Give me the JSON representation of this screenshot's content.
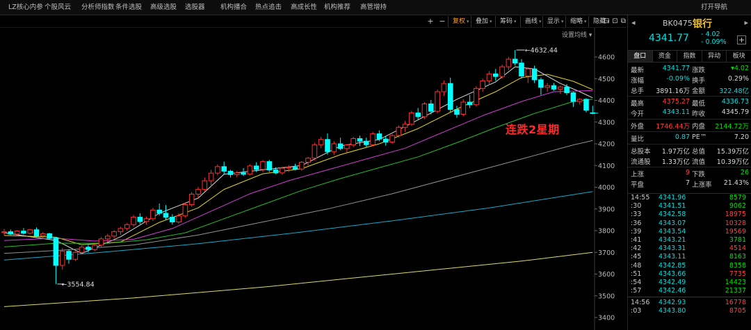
{
  "menu": {
    "items": [
      "LZ核心内参",
      "个股风云",
      "分析师指数",
      "条件选股",
      "高级选股",
      "选股器",
      "机构播合",
      "热点追击",
      "高成长性",
      "机构推荐",
      "高管增持"
    ],
    "right_link": "打开导航"
  },
  "toolbar": {
    "icons": [
      "+",
      "−"
    ],
    "items": [
      {
        "label": "复权",
        "active": true
      },
      {
        "label": "叠加",
        "active": false
      },
      {
        "label": "筹码",
        "active": false
      },
      {
        "label": "画线",
        "active": false
      },
      {
        "label": "显示",
        "active": false
      },
      {
        "label": "缩略",
        "active": false
      },
      {
        "label": "隐藏",
        "active": false
      }
    ],
    "window_icons": [
      "⊟",
      "⊡",
      "⧉"
    ]
  },
  "chart": {
    "settings_label": "设置均线",
    "annotation": "连跌2星期",
    "high_label": "4632.44",
    "low_label": "3554.84"
  },
  "chart_data": {
    "type": "candlestick",
    "title": "",
    "y_ticks": [
      4600,
      4500,
      4400,
      4300,
      4200,
      4100,
      4000,
      3900,
      3800,
      3700,
      3600,
      3500,
      3400
    ],
    "ylim": [
      3400,
      4660
    ],
    "candles": [
      {
        "o": 3791,
        "h": 3808,
        "l": 3780,
        "c": 3795
      },
      {
        "o": 3795,
        "h": 3805,
        "l": 3780,
        "c": 3784
      },
      {
        "o": 3784,
        "h": 3802,
        "l": 3776,
        "c": 3798
      },
      {
        "o": 3798,
        "h": 3812,
        "l": 3782,
        "c": 3788
      },
      {
        "o": 3788,
        "h": 3808,
        "l": 3782,
        "c": 3804
      },
      {
        "o": 3804,
        "h": 3815,
        "l": 3770,
        "c": 3776
      },
      {
        "o": 3776,
        "h": 3793,
        "l": 3762,
        "c": 3786
      },
      {
        "o": 3786,
        "h": 3790,
        "l": 3760,
        "c": 3766
      },
      {
        "o": 3766,
        "h": 3770,
        "l": 3554,
        "c": 3640
      },
      {
        "o": 3640,
        "h": 3720,
        "l": 3620,
        "c": 3705
      },
      {
        "o": 3705,
        "h": 3715,
        "l": 3648,
        "c": 3668
      },
      {
        "o": 3668,
        "h": 3705,
        "l": 3660,
        "c": 3700
      },
      {
        "o": 3700,
        "h": 3730,
        "l": 3690,
        "c": 3724
      },
      {
        "o": 3724,
        "h": 3735,
        "l": 3700,
        "c": 3713
      },
      {
        "o": 3713,
        "h": 3740,
        "l": 3705,
        "c": 3733
      },
      {
        "o": 3733,
        "h": 3770,
        "l": 3726,
        "c": 3762
      },
      {
        "o": 3762,
        "h": 3785,
        "l": 3748,
        "c": 3775
      },
      {
        "o": 3775,
        "h": 3802,
        "l": 3765,
        "c": 3795
      },
      {
        "o": 3795,
        "h": 3818,
        "l": 3780,
        "c": 3810
      },
      {
        "o": 3810,
        "h": 3835,
        "l": 3800,
        "c": 3828
      },
      {
        "o": 3828,
        "h": 3872,
        "l": 3818,
        "c": 3862
      },
      {
        "o": 3862,
        "h": 3880,
        "l": 3830,
        "c": 3842
      },
      {
        "o": 3842,
        "h": 3865,
        "l": 3828,
        "c": 3855
      },
      {
        "o": 3855,
        "h": 3905,
        "l": 3845,
        "c": 3895
      },
      {
        "o": 3895,
        "h": 3925,
        "l": 3870,
        "c": 3880
      },
      {
        "o": 3880,
        "h": 3918,
        "l": 3850,
        "c": 3862
      },
      {
        "o": 3862,
        "h": 3876,
        "l": 3828,
        "c": 3840
      },
      {
        "o": 3840,
        "h": 3880,
        "l": 3832,
        "c": 3868
      },
      {
        "o": 3868,
        "h": 3930,
        "l": 3860,
        "c": 3920
      },
      {
        "o": 3920,
        "h": 3978,
        "l": 3910,
        "c": 3968
      },
      {
        "o": 3968,
        "h": 4002,
        "l": 3950,
        "c": 3990
      },
      {
        "o": 3990,
        "h": 4045,
        "l": 3980,
        "c": 4030
      },
      {
        "o": 4030,
        "h": 4080,
        "l": 4000,
        "c": 4065
      },
      {
        "o": 4065,
        "h": 4105,
        "l": 4055,
        "c": 4095
      },
      {
        "o": 4095,
        "h": 4118,
        "l": 4060,
        "c": 4074
      },
      {
        "o": 4074,
        "h": 4080,
        "l": 4045,
        "c": 4058
      },
      {
        "o": 4058,
        "h": 4075,
        "l": 4046,
        "c": 4066
      },
      {
        "o": 4066,
        "h": 4088,
        "l": 4052,
        "c": 4060
      },
      {
        "o": 4060,
        "h": 4106,
        "l": 4054,
        "c": 4098
      },
      {
        "o": 4098,
        "h": 4115,
        "l": 4070,
        "c": 4082
      },
      {
        "o": 4082,
        "h": 4125,
        "l": 4070,
        "c": 4118
      },
      {
        "o": 4118,
        "h": 4126,
        "l": 4070,
        "c": 4080
      },
      {
        "o": 4080,
        "h": 4092,
        "l": 4060,
        "c": 4066
      },
      {
        "o": 4066,
        "h": 4096,
        "l": 4058,
        "c": 4088
      },
      {
        "o": 4088,
        "h": 4102,
        "l": 4070,
        "c": 4092
      },
      {
        "o": 4092,
        "h": 4108,
        "l": 4078,
        "c": 4084
      },
      {
        "o": 4084,
        "h": 4120,
        "l": 4076,
        "c": 4115
      },
      {
        "o": 4115,
        "h": 4140,
        "l": 4100,
        "c": 4134
      },
      {
        "o": 4134,
        "h": 4205,
        "l": 4124,
        "c": 4196
      },
      {
        "o": 4196,
        "h": 4232,
        "l": 4180,
        "c": 4220
      },
      {
        "o": 4220,
        "h": 4248,
        "l": 4150,
        "c": 4164
      },
      {
        "o": 4164,
        "h": 4212,
        "l": 4150,
        "c": 4200
      },
      {
        "o": 4200,
        "h": 4228,
        "l": 4170,
        "c": 4178
      },
      {
        "o": 4178,
        "h": 4200,
        "l": 4160,
        "c": 4195
      },
      {
        "o": 4195,
        "h": 4232,
        "l": 4185,
        "c": 4224
      },
      {
        "o": 4224,
        "h": 4238,
        "l": 4190,
        "c": 4212
      },
      {
        "o": 4212,
        "h": 4228,
        "l": 4185,
        "c": 4196
      },
      {
        "o": 4196,
        "h": 4255,
        "l": 4188,
        "c": 4246
      },
      {
        "o": 4246,
        "h": 4262,
        "l": 4212,
        "c": 4222
      },
      {
        "o": 4222,
        "h": 4236,
        "l": 4192,
        "c": 4208
      },
      {
        "o": 4208,
        "h": 4245,
        "l": 4200,
        "c": 4238
      },
      {
        "o": 4238,
        "h": 4285,
        "l": 4230,
        "c": 4276
      },
      {
        "o": 4276,
        "h": 4305,
        "l": 4255,
        "c": 4290
      },
      {
        "o": 4290,
        "h": 4352,
        "l": 4282,
        "c": 4342
      },
      {
        "o": 4342,
        "h": 4365,
        "l": 4310,
        "c": 4325
      },
      {
        "o": 4325,
        "h": 4392,
        "l": 4315,
        "c": 4384
      },
      {
        "o": 4384,
        "h": 4402,
        "l": 4335,
        "c": 4350
      },
      {
        "o": 4350,
        "h": 4450,
        "l": 4340,
        "c": 4440
      },
      {
        "o": 4440,
        "h": 4492,
        "l": 4420,
        "c": 4478
      },
      {
        "o": 4478,
        "h": 4505,
        "l": 4345,
        "c": 4358
      },
      {
        "o": 4358,
        "h": 4375,
        "l": 4320,
        "c": 4336
      },
      {
        "o": 4336,
        "h": 4405,
        "l": 4328,
        "c": 4392
      },
      {
        "o": 4392,
        "h": 4425,
        "l": 4365,
        "c": 4380
      },
      {
        "o": 4380,
        "h": 4465,
        "l": 4372,
        "c": 4455
      },
      {
        "o": 4455,
        "h": 4500,
        "l": 4440,
        "c": 4490
      },
      {
        "o": 4490,
        "h": 4535,
        "l": 4470,
        "c": 4522
      },
      {
        "o": 4522,
        "h": 4545,
        "l": 4490,
        "c": 4510
      },
      {
        "o": 4510,
        "h": 4565,
        "l": 4500,
        "c": 4555
      },
      {
        "o": 4555,
        "h": 4600,
        "l": 4540,
        "c": 4590
      },
      {
        "o": 4590,
        "h": 4632,
        "l": 4560,
        "c": 4572
      },
      {
        "o": 4572,
        "h": 4590,
        "l": 4500,
        "c": 4512
      },
      {
        "o": 4512,
        "h": 4552,
        "l": 4480,
        "c": 4545
      },
      {
        "o": 4545,
        "h": 4560,
        "l": 4480,
        "c": 4495
      },
      {
        "o": 4495,
        "h": 4505,
        "l": 4425,
        "c": 4460
      },
      {
        "o": 4460,
        "h": 4480,
        "l": 4440,
        "c": 4468
      },
      {
        "o": 4468,
        "h": 4480,
        "l": 4445,
        "c": 4452
      },
      {
        "o": 4452,
        "h": 4468,
        "l": 4430,
        "c": 4462
      },
      {
        "o": 4462,
        "h": 4475,
        "l": 4425,
        "c": 4435
      },
      {
        "o": 4435,
        "h": 4440,
        "l": 4370,
        "c": 4395
      },
      {
        "o": 4395,
        "h": 4410,
        "l": 4380,
        "c": 4405
      },
      {
        "o": 4405,
        "h": 4410,
        "l": 4345,
        "c": 4355
      },
      {
        "o": 4343,
        "h": 4375,
        "l": 4336,
        "c": 4341
      }
    ],
    "moving_averages": [
      {
        "name": "MA5",
        "color": "#e8e8e8",
        "values": [
          [
            0,
            3790
          ],
          [
            8,
            3755
          ],
          [
            12,
            3695
          ],
          [
            18,
            3772
          ],
          [
            24,
            3880
          ],
          [
            30,
            3950
          ],
          [
            34,
            4060
          ],
          [
            40,
            4080
          ],
          [
            46,
            4100
          ],
          [
            52,
            4190
          ],
          [
            58,
            4220
          ],
          [
            64,
            4310
          ],
          [
            70,
            4405
          ],
          [
            76,
            4485
          ],
          [
            79,
            4555
          ],
          [
            82,
            4545
          ],
          [
            86,
            4478
          ],
          [
            89,
            4440
          ],
          [
            91,
            4412
          ]
        ]
      },
      {
        "name": "MA10",
        "color": "#f2e01a",
        "values": [
          [
            0,
            3778
          ],
          [
            8,
            3770
          ],
          [
            12,
            3735
          ],
          [
            18,
            3748
          ],
          [
            24,
            3838
          ],
          [
            30,
            3905
          ],
          [
            34,
            3990
          ],
          [
            40,
            4062
          ],
          [
            46,
            4085
          ],
          [
            52,
            4150
          ],
          [
            58,
            4200
          ],
          [
            64,
            4270
          ],
          [
            70,
            4360
          ],
          [
            76,
            4440
          ],
          [
            80,
            4505
          ],
          [
            84,
            4520
          ],
          [
            88,
            4488
          ],
          [
            91,
            4450
          ]
        ]
      },
      {
        "name": "MA20",
        "color": "#e040e0",
        "values": [
          [
            0,
            3755
          ],
          [
            8,
            3765
          ],
          [
            14,
            3752
          ],
          [
            20,
            3760
          ],
          [
            26,
            3810
          ],
          [
            32,
            3890
          ],
          [
            38,
            3970
          ],
          [
            44,
            4030
          ],
          [
            50,
            4080
          ],
          [
            56,
            4130
          ],
          [
            62,
            4180
          ],
          [
            68,
            4255
          ],
          [
            74,
            4330
          ],
          [
            80,
            4395
          ],
          [
            85,
            4440
          ],
          [
            91,
            4445
          ]
        ]
      },
      {
        "name": "MA30",
        "color": "#28c828",
        "values": [
          [
            0,
            3725
          ],
          [
            8,
            3742
          ],
          [
            16,
            3742
          ],
          [
            22,
            3758
          ],
          [
            28,
            3790
          ],
          [
            34,
            3855
          ],
          [
            40,
            3920
          ],
          [
            46,
            3985
          ],
          [
            52,
            4040
          ],
          [
            58,
            4090
          ],
          [
            64,
            4140
          ],
          [
            70,
            4205
          ],
          [
            76,
            4275
          ],
          [
            82,
            4340
          ],
          [
            88,
            4395
          ],
          [
            91,
            4405
          ]
        ]
      },
      {
        "name": "MA60",
        "color": "#9a9a9a",
        "values": [
          [
            0,
            3695
          ],
          [
            10,
            3712
          ],
          [
            20,
            3734
          ],
          [
            30,
            3780
          ],
          [
            40,
            3840
          ],
          [
            50,
            3900
          ],
          [
            60,
            3970
          ],
          [
            70,
            4050
          ],
          [
            80,
            4130
          ],
          [
            88,
            4195
          ],
          [
            91,
            4215
          ]
        ]
      },
      {
        "name": "MA120",
        "color": "#16b4d6",
        "values": [
          [
            0,
            3665
          ],
          [
            15,
            3700
          ],
          [
            30,
            3740
          ],
          [
            45,
            3790
          ],
          [
            60,
            3845
          ],
          [
            75,
            3905
          ],
          [
            91,
            3980
          ]
        ]
      },
      {
        "name": "MA250",
        "color": "#e8e870",
        "values": [
          [
            0,
            3450
          ],
          [
            20,
            3490
          ],
          [
            40,
            3540
          ],
          [
            60,
            3600
          ],
          [
            80,
            3660
          ],
          [
            91,
            3700
          ]
        ]
      }
    ]
  },
  "panel": {
    "nav_prev": "◂",
    "nav_next": "▸",
    "code": "BK0475",
    "name": "银行",
    "price": "4341.77",
    "change": "- 4.02",
    "change_pct": "- 0.09%",
    "plus": "+",
    "tabs": [
      "盘口",
      "资金",
      "指数",
      "异动",
      "板块"
    ],
    "quotes": [
      {
        "l1": "最新",
        "v1": "4341.77",
        "c1": "#00e0e0",
        "l2": "涨跌",
        "v2": "▾4.02",
        "c2": "#00e000"
      },
      {
        "l1": "涨幅",
        "v1": "-0.09%",
        "c1": "#00e0e0",
        "l2": "换手",
        "v2": "0.29%",
        "c2": "#d8d8d8"
      },
      {
        "l1": "总手",
        "v1": "3891.16万",
        "c1": "#d8d8d8",
        "l2": "金额",
        "v2": "322.48亿",
        "c2": "#00e0e0"
      },
      {
        "l1": "最高",
        "v1": "4375.27",
        "c1": "#ff4040",
        "l2": "最低",
        "v2": "4336.73",
        "c2": "#00e0e0"
      },
      {
        "l1": "今开",
        "v1": "4343.11",
        "c1": "#00e0e0",
        "l2": "昨收",
        "v2": "4345.79",
        "c2": "#d8d8d8"
      },
      {
        "l1": "外盘",
        "v1": "1746.44万",
        "c1": "#ff4040",
        "l2": "内盘",
        "v2": "2144.72万",
        "c2": "#00e000"
      },
      {
        "l1": "量比",
        "v1": "0.87",
        "c1": "#00e0e0",
        "l2": "PE™",
        "v2": "7.20",
        "c2": "#d8d8d8"
      },
      {
        "l1": "总股本",
        "v1": "1.97万亿",
        "c1": "#d8d8d8",
        "l2": "总值",
        "v2": "15.39万亿",
        "c2": "#d8d8d8"
      },
      {
        "l1": "流通股",
        "v1": "1.33万亿",
        "c1": "#d8d8d8",
        "l2": "流值",
        "v2": "10.39万亿",
        "c2": "#d8d8d8"
      },
      {
        "l1": "上涨",
        "v1": "9",
        "c1": "#ff4040",
        "l2": "下跌",
        "v2": "26",
        "c2": "#00e000"
      },
      {
        "l1": "平盘",
        "v1": "7",
        "c1": "#d8d8d8",
        "l2": "上涨率",
        "v2": "21.43%",
        "c2": "#d8d8d8"
      }
    ],
    "ticks": [
      {
        "t": "14:55",
        "p": "4341.96",
        "v": "8579",
        "c": "#00e000",
        "bar": false
      },
      {
        "t": ":30",
        "p": "4341.51",
        "v": "9062",
        "c": "#00e000",
        "bar": true
      },
      {
        "t": ":33",
        "p": "4342.58",
        "v": "18975",
        "c": "#ff4040",
        "bar": true
      },
      {
        "t": ":36",
        "p": "4343.07",
        "v": "10328",
        "c": "#ff4040",
        "bar": true
      },
      {
        "t": ":39",
        "p": "4343.54",
        "v": "19569",
        "c": "#ff4040",
        "bar": true
      },
      {
        "t": ":41",
        "p": "4343.21",
        "v": "3781",
        "c": "#00e000",
        "bar": true
      },
      {
        "t": ":42",
        "p": "4343.31",
        "v": "4514",
        "c": "#ff4040",
        "bar": true
      },
      {
        "t": ":45",
        "p": "4343.11",
        "v": "8163",
        "c": "#00e000",
        "bar": true
      },
      {
        "t": ":48",
        "p": "4342.85",
        "v": "8358",
        "c": "#00e000",
        "bar": true
      },
      {
        "t": ":51",
        "p": "4343.66",
        "v": "7735",
        "c": "#ff4040",
        "bar": true
      },
      {
        "t": ":54",
        "p": "4342.49",
        "v": "14423",
        "c": "#00e000",
        "bar": true
      },
      {
        "t": ":57",
        "p": "4342.46",
        "v": "21337",
        "c": "#00e000",
        "bar": true
      },
      {
        "t": "14:56",
        "p": "4342.93",
        "v": "16778",
        "c": "#ff4040",
        "bar": false
      },
      {
        "t": ":03",
        "p": "4343.80",
        "v": "8705",
        "c": "#ff4040",
        "bar": true
      }
    ]
  },
  "colors": {
    "up": "#ff3030",
    "down": "#00ffff",
    "grid": "#1e1e1e",
    "axis_text": "#bbbbbb",
    "annotation": "#ff2a2a",
    "active": "#ff9d1e"
  }
}
